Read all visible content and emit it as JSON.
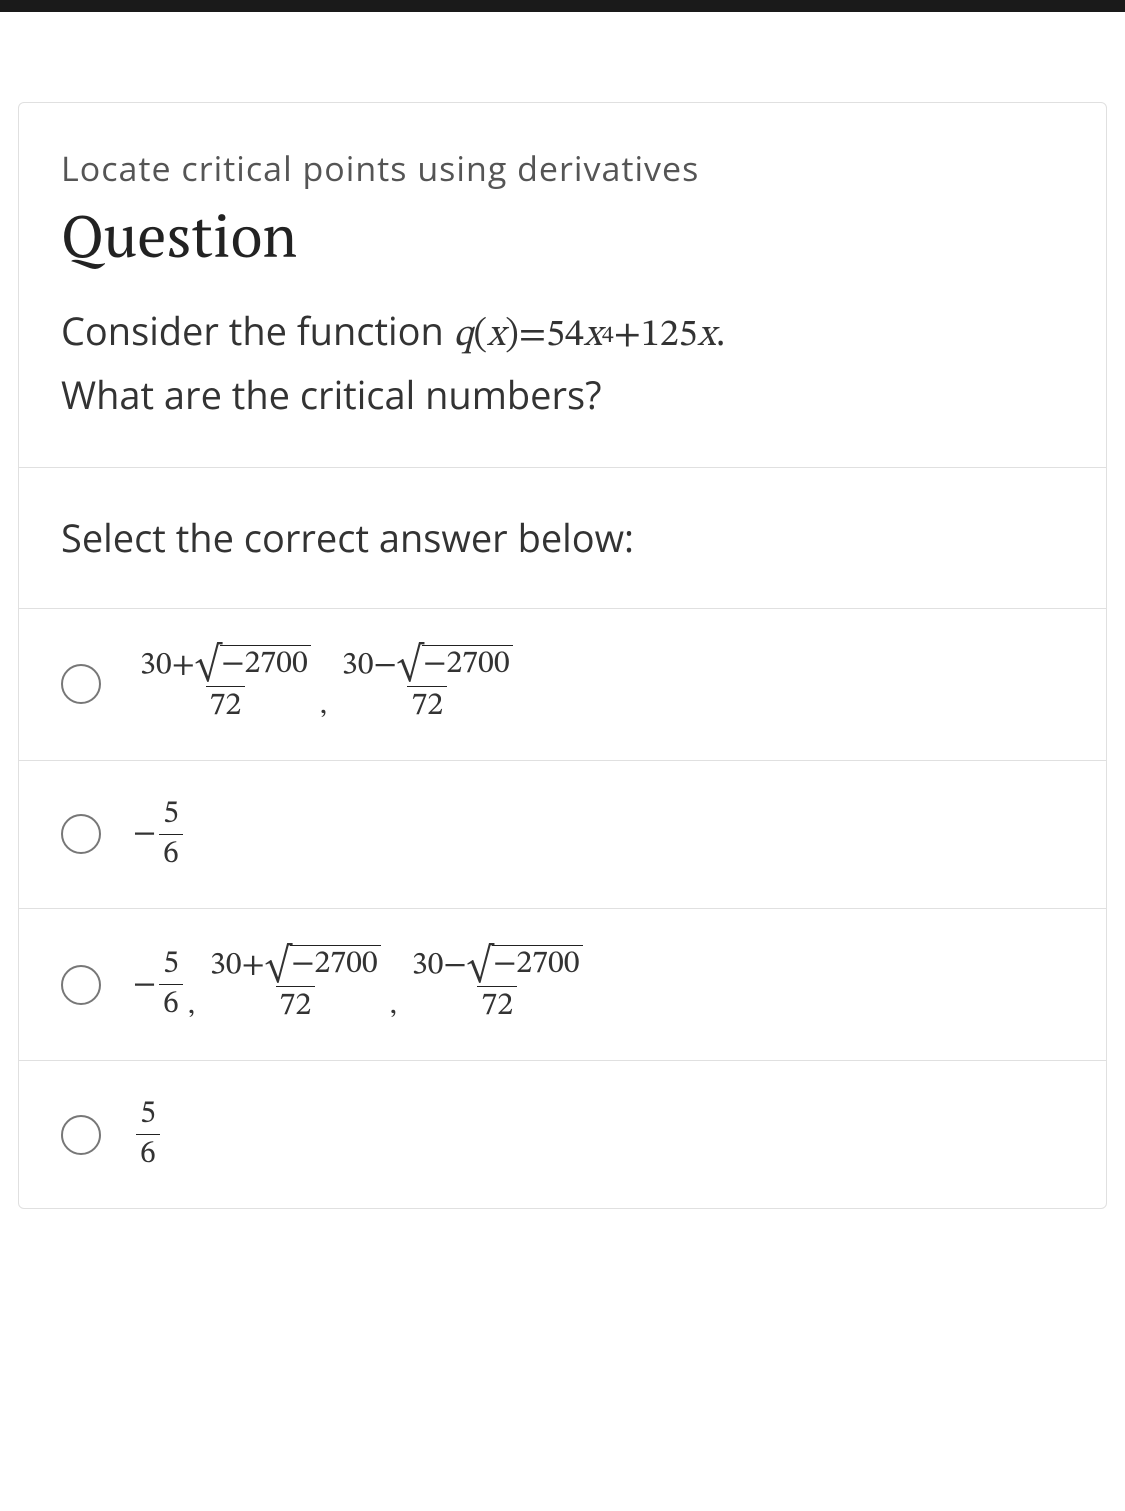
{
  "topic": "Locate critical points using derivatives",
  "question_label": "Question",
  "prompt": {
    "pre": "Consider the function ",
    "func_name": "q",
    "var": "x",
    "eq": " = ",
    "coef1": "54",
    "exp": "4",
    "plus": " + ",
    "coef2": "125",
    "period": ".",
    "line2": "What are the critical numbers?"
  },
  "instruction": "Select the correct answer below:",
  "options": {
    "a": {
      "a_num_n": "30",
      "a_sign": "+",
      "radicand": "−2700",
      "a_den": "72",
      "b_num_n": "30",
      "b_sign": "−"
    },
    "b": {
      "neg": "−",
      "num": "5",
      "den": "6"
    },
    "c": {
      "neg": "−",
      "num": "5",
      "den": "6",
      "a_num_n": "30",
      "a_sign": "+",
      "radicand": "−2700",
      "a_den": "72",
      "b_num_n": "30",
      "b_sign": "−"
    },
    "d": {
      "num": "5",
      "den": "6"
    }
  }
}
